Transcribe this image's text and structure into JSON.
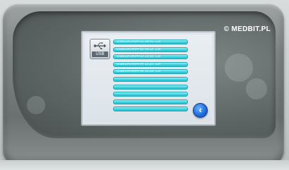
{
  "watermark": "© MEDBIT.PL",
  "usb_button": {
    "icon": "usb-icon",
    "label": "USB"
  },
  "file_list": {
    "rows": [
      "USB/DATA/04-01 08:41 .CR",
      "USB/DATA/04-02 09:12 .CR",
      "USB/DATA/04-03 10:05 .CR",
      "USB/DATA/04-04 11:20 .CR",
      "USB/DATA/04-05 12:33 .CR",
      "",
      "",
      "",
      "",
      ""
    ]
  },
  "back_button": {
    "icon": "chevron-left-icon",
    "label": "‹"
  },
  "colors": {
    "row_fill": "#3fd3e0",
    "back_button": "#1f6fe0",
    "screen_bg": "#e3e9ee"
  }
}
